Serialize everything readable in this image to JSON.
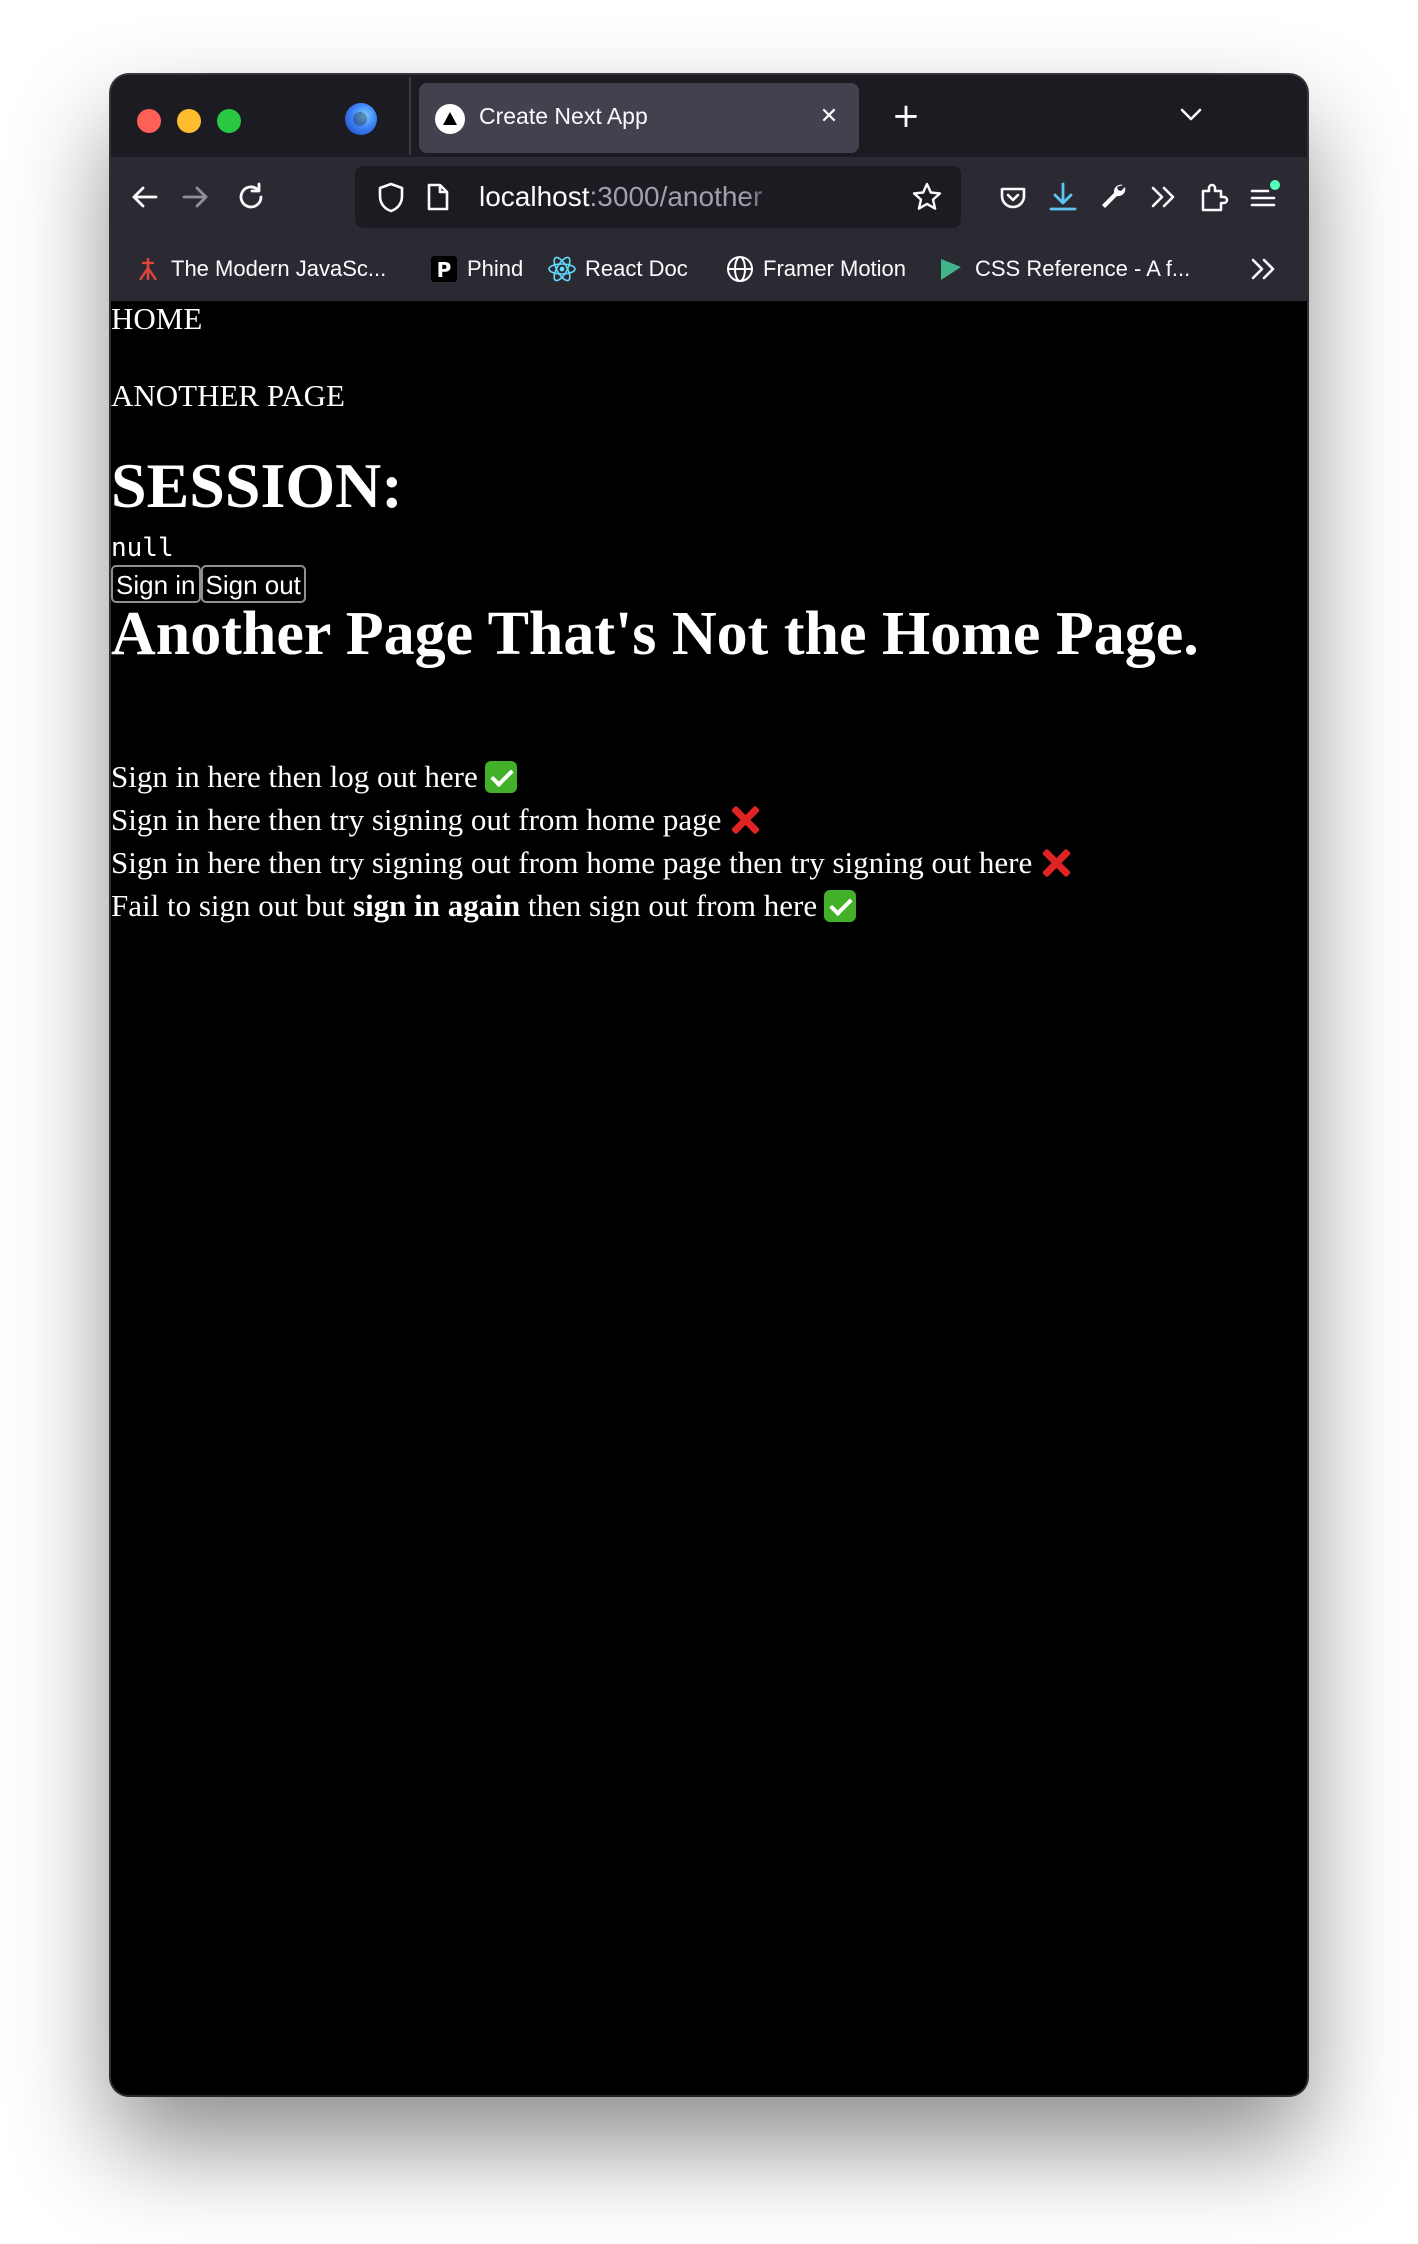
{
  "browser": {
    "tab": {
      "title": "Create Next App"
    },
    "url": {
      "host": "localhost",
      "path": ":3000/another"
    },
    "bookmarks": [
      {
        "label": "The Modern JavaSc...",
        "icon": "javascript-info-icon"
      },
      {
        "label": "Phind",
        "icon": "phind-icon"
      },
      {
        "label": "React Doc",
        "icon": "react-icon"
      },
      {
        "label": "Framer Motion",
        "icon": "globe-icon"
      },
      {
        "label": "CSS Reference - A f...",
        "icon": "css-reference-icon"
      }
    ],
    "accent_color": "#7dd3fc"
  },
  "page": {
    "nav": {
      "home": "HOME",
      "another": "ANOTHER PAGE"
    },
    "session_heading": "SESSION:",
    "session_value": "null",
    "buttons": {
      "sign_in": "Sign in",
      "sign_out": "Sign out"
    },
    "heading": "Another Page That's Not the Home Page.",
    "lines": [
      {
        "text": "Sign in here then log out here",
        "status": "check"
      },
      {
        "text": "Sign in here then try signing out from home page",
        "status": "cross"
      },
      {
        "text": "Sign in here then try signing out from home page then try signing out here",
        "status": "cross"
      }
    ],
    "last_line": {
      "before": "Fail to sign out but ",
      "bold": "sign in again",
      "after": " then sign out from here",
      "status": "check"
    }
  }
}
